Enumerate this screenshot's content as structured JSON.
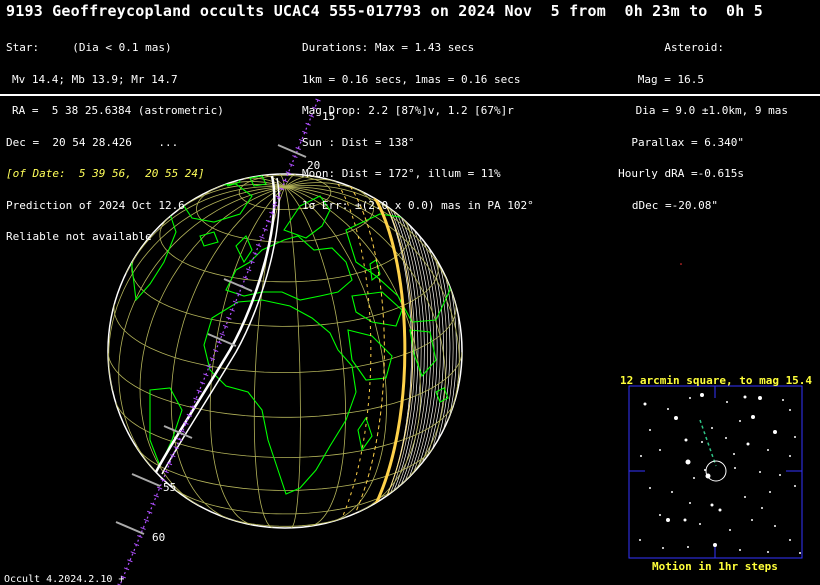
{
  "title": "9193 Geoffreycopland occults UCAC4 555-017793 on 2024 Nov  5 from  0h 23m to  0h 5",
  "star": {
    "heading": "Star:",
    "dia": "(Dia < 0.1 mas)",
    "mags": "Mv 14.4; Mb 13.9; Mr 14.7",
    "ra": "RA =  5 38 25.6384 (astrometric)",
    "dec": "Dec =  20 54 28.426    ...",
    "of_date": "[of Date:  5 39 56,  20 55 24]",
    "prediction": "Prediction of 2024 Oct 12.6",
    "reliable": "Reliable not available"
  },
  "event": {
    "durations": "Durations: Max = 1.43 secs",
    "scale": "1km = 0.16 secs, 1mas = 0.16 secs",
    "mag_drop": "Mag Drop: 2.2 [87%]v, 1.2 [67%]r",
    "sun": "Sun : Dist = 138°",
    "moon": "Moon: Dist = 172°, illum = 11%",
    "error": "1σ Err: ±(2.0 x 0.0) mas in PA 102°"
  },
  "asteroid": {
    "heading": "Asteroid:",
    "mag": "Mag = 16.5",
    "dia": "Dia = 9.0 ±1.0km, 9 mas",
    "parallax": "Parallax = 6.340\"",
    "hourly_dra": "Hourly dRA =-0.615s",
    "ddec": "dDec =-20.08\""
  },
  "path_labels": [
    "15",
    "20",
    "55",
    "60"
  ],
  "inset": {
    "caption": "12 arcmin square, to mag 15.4",
    "footer": "Motion in 1hr steps"
  },
  "version": "Occult 4.2024.2.10",
  "colors": {
    "background": "#000000",
    "graticule": "#c8c864",
    "coastline": "#00ff00",
    "path": "#ffffff",
    "limb": "#ffd24a",
    "inset_frame": "#3333ff",
    "caption": "#ffff3a"
  }
}
